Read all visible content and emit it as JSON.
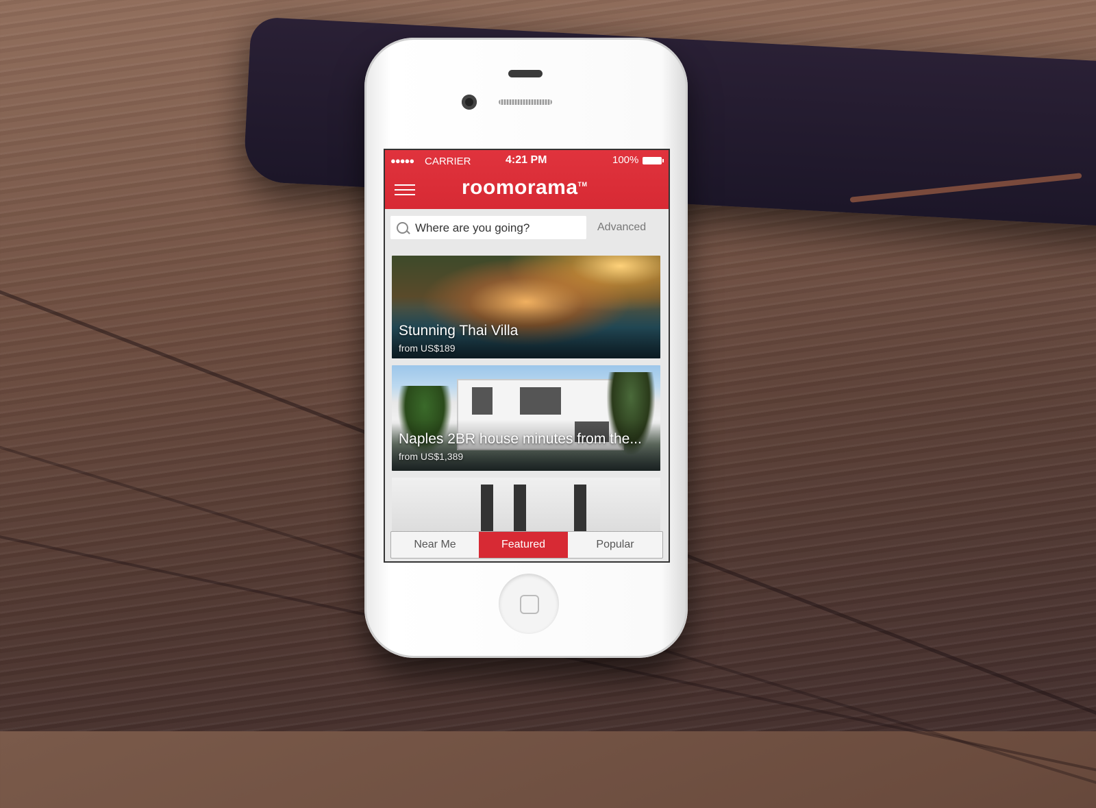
{
  "status_bar": {
    "signal": "●●●●●",
    "carrier": "CARRIER",
    "time": "4:21 PM",
    "battery": "100%"
  },
  "header": {
    "logo": "roomorama",
    "logo_tm": "TM",
    "menu_icon": "hamburger-menu-icon"
  },
  "search": {
    "placeholder": "Where are you going?",
    "advanced_label": "Advanced",
    "icon": "search-icon"
  },
  "listings": [
    {
      "title": "Stunning Thai Villa",
      "price": "from US$189"
    },
    {
      "title": "Naples 2BR house minutes from the...",
      "price": "from US$1,389"
    }
  ],
  "tabs": [
    {
      "label": "Near Me"
    },
    {
      "label": "Featured",
      "active": true
    },
    {
      "label": "Popular"
    }
  ],
  "colors": {
    "brand_red": "#d72a34"
  }
}
